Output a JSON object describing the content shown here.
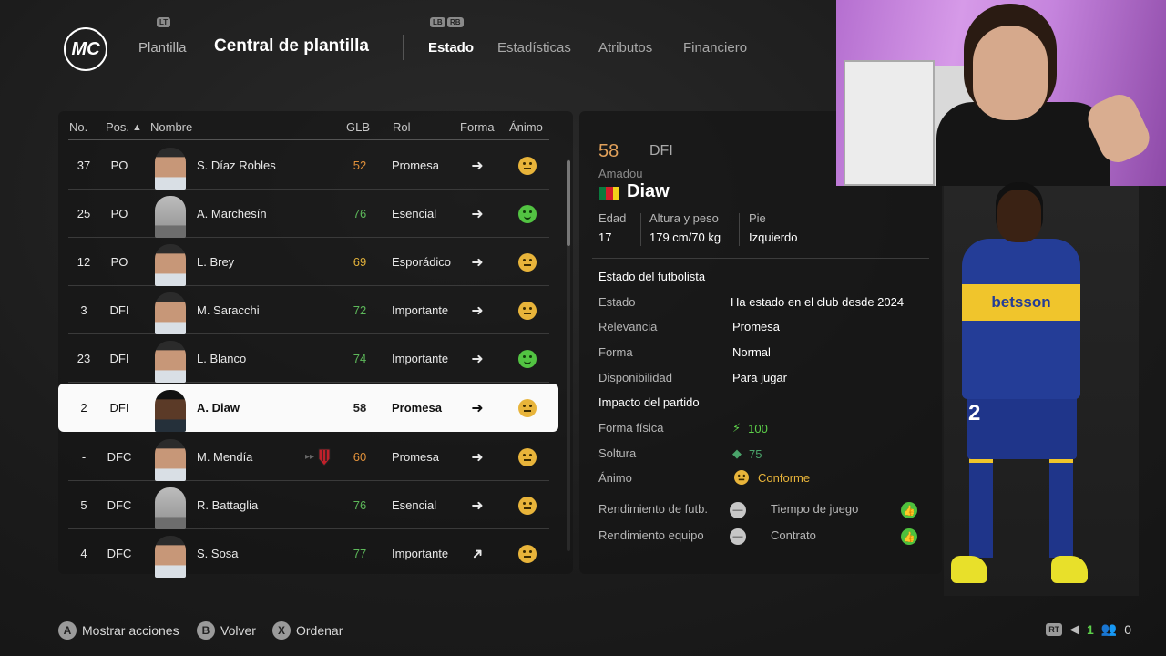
{
  "header": {
    "logo": "MC",
    "lt_hint": "LT",
    "plantilla": "Plantilla",
    "title": "Central de plantilla",
    "lb_hint": "LB",
    "rb_hint": "RB",
    "tabs": [
      {
        "label": "Estado"
      },
      {
        "label": "Estadísticas"
      },
      {
        "label": "Atributos"
      },
      {
        "label": "Financiero"
      }
    ]
  },
  "table": {
    "headers": {
      "no": "No.",
      "pos": "Pos.",
      "sort_arrow": "▲",
      "nombre": "Nombre",
      "glb": "GLB",
      "rol": "Rol",
      "forma": "Forma",
      "animo": "Ánimo"
    },
    "rows": [
      {
        "no": "37",
        "pos": "PO",
        "name": "S. Díaz Robles",
        "glb": "52",
        "glb_color": "#e0903a",
        "rol": "Promesa",
        "forma": "➜",
        "mood": "neutral"
      },
      {
        "no": "25",
        "pos": "PO",
        "name": "A. Marchesín",
        "glb": "76",
        "glb_color": "#5db85a",
        "rol": "Esencial",
        "forma": "➜",
        "mood": "happy"
      },
      {
        "no": "12",
        "pos": "PO",
        "name": "L. Brey",
        "glb": "69",
        "glb_color": "#e0b03a",
        "rol": "Esporádico",
        "forma": "➜",
        "mood": "neutral"
      },
      {
        "no": "3",
        "pos": "DFI",
        "name": "M. Saracchi",
        "glb": "72",
        "glb_color": "#5db85a",
        "rol": "Importante",
        "forma": "➜",
        "mood": "neutral"
      },
      {
        "no": "23",
        "pos": "DFI",
        "name": "L. Blanco",
        "glb": "74",
        "glb_color": "#5db85a",
        "rol": "Importante",
        "forma": "➜",
        "mood": "happy"
      },
      {
        "no": "2",
        "pos": "DFI",
        "name": "A. Diaw",
        "glb": "58",
        "glb_color": "#222222",
        "rol": "Promesa",
        "forma": "➜",
        "mood": "neutral"
      },
      {
        "no": "-",
        "pos": "DFC",
        "name": "M. Mendía",
        "glb": "60",
        "glb_color": "#e0903a",
        "rol": "Promesa",
        "forma": "➜",
        "mood": "neutral"
      },
      {
        "no": "5",
        "pos": "DFC",
        "name": "R. Battaglia",
        "glb": "76",
        "glb_color": "#5db85a",
        "rol": "Esencial",
        "forma": "➜",
        "mood": "neutral"
      },
      {
        "no": "4",
        "pos": "DFC",
        "name": "S. Sosa",
        "glb": "77",
        "glb_color": "#5db85a",
        "rol": "Importante",
        "forma": "➜",
        "mood": "neutral"
      }
    ]
  },
  "player": {
    "rating": "58",
    "position": "DFI",
    "first_name": "Amadou",
    "last_name": "Diaw",
    "edad_label": "Edad",
    "edad": "17",
    "altura_label": "Altura y peso",
    "altura": "179 cm/70 kg",
    "pie_label": "Pie",
    "pie": "Izquierdo",
    "estado_section": "Estado del futbolista",
    "estado_label": "Estado",
    "estado": "Ha estado en el club desde 2024",
    "relevancia_label": "Relevancia",
    "relevancia": "Promesa",
    "forma_label": "Forma",
    "forma": "Normal",
    "disp_label": "Disponibilidad",
    "disp": "Para jugar",
    "impacto_section": "Impacto del partido",
    "forma_fisica_label": "Forma física",
    "forma_fisica": "100",
    "soltura_label": "Soltura",
    "soltura": "75",
    "animo_label": "Ánimo",
    "animo": "Conforme",
    "rend_futb_label": "Rendimiento de futb.",
    "rend_equipo_label": "Rendimiento equipo",
    "tiempo_label": "Tiempo de juego",
    "contrato_label": "Contrato",
    "shirt_sponsor": "betsson",
    "shirt_number": "2"
  },
  "footer": {
    "actions": [
      {
        "glyph": "A",
        "label": "Mostrar acciones"
      },
      {
        "glyph": "B",
        "label": "Volver"
      },
      {
        "glyph": "X",
        "label": "Ordenar"
      }
    ],
    "rt": "RT",
    "count1": "1",
    "count2": "0"
  }
}
